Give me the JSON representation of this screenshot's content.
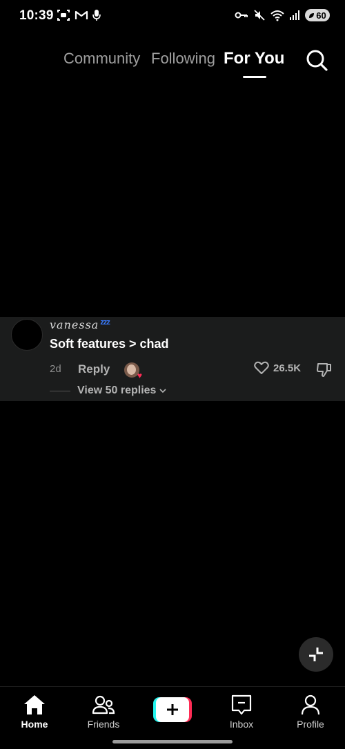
{
  "status_bar": {
    "time": "10:39",
    "battery": "60"
  },
  "top_nav": {
    "tabs": [
      {
        "label": "Community"
      },
      {
        "label": "Following"
      },
      {
        "label": "For You"
      }
    ],
    "active_tab": "For You"
  },
  "comment": {
    "username": "vanessa",
    "username_decoration": "zzz",
    "text": "Soft features > chad",
    "time": "2d",
    "reply_label": "Reply",
    "like_count": "26.5K",
    "view_replies_label": "View 50 replies"
  },
  "bottom_nav": {
    "items": [
      {
        "label": "Home"
      },
      {
        "label": "Friends"
      },
      {
        "label": "Inbox"
      },
      {
        "label": "Profile"
      }
    ],
    "create_symbol": "+"
  },
  "colors": {
    "background": "#000000",
    "comment_card": "#1b1c1c",
    "accent_red": "#fe2c55",
    "accent_cyan": "#25f4ee",
    "zzz_blue": "#3a7bff"
  }
}
